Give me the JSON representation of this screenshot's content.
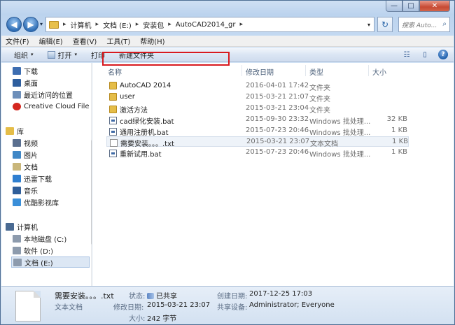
{
  "window": {
    "caption": {
      "minimize": "—",
      "maximize": "□",
      "close": "✕"
    }
  },
  "address": {
    "crumbs": [
      "计算机",
      "文档 (E:)",
      "安装包",
      "AutoCAD2014_gr"
    ],
    "search_placeholder": "搜索 Auto...",
    "back_glyph": "◀",
    "forward_glyph": "▶",
    "refresh_glyph": "↻",
    "search_glyph": "⌕",
    "separator_glyph": "▸",
    "dropdown_glyph": "▾",
    "crumb_dropdown_glyph": "▾"
  },
  "menubar": [
    "文件(F)",
    "编辑(E)",
    "查看(V)",
    "工具(T)",
    "帮助(H)"
  ],
  "toolbar": {
    "organize": "组织",
    "open": "打开",
    "print": "打印",
    "new_folder": "新建文件夹",
    "arrow_glyph": "▾",
    "view_glyph": "☷",
    "pane_glyph": "▯",
    "help_glyph": "?"
  },
  "sidebar": {
    "items": [
      {
        "label": "下载",
        "icon": "download-icon",
        "color": "#3d6db1"
      },
      {
        "label": "桌面",
        "icon": "desktop-icon",
        "color": "#2e5e9e"
      },
      {
        "label": "最近访问的位置",
        "icon": "recent-places-icon",
        "color": "#6d8fba"
      },
      {
        "label": "Creative Cloud File",
        "icon": "creative-cloud-icon",
        "color": "#d4271f"
      },
      {
        "label": "库",
        "icon": "libraries-icon",
        "color": "#e5bd48"
      },
      {
        "label": "视频",
        "icon": "videos-icon",
        "color": "#5a6f8f"
      },
      {
        "label": "图片",
        "icon": "pictures-icon",
        "color": "#3f87c6"
      },
      {
        "label": "文档",
        "icon": "documents-icon",
        "color": "#c9b67a"
      },
      {
        "label": "迅雷下载",
        "icon": "thunder-download-icon",
        "color": "#2f7fd0"
      },
      {
        "label": "音乐",
        "icon": "music-icon",
        "color": "#2f5e9a"
      },
      {
        "label": "优酷影视库",
        "icon": "youku-library-icon",
        "color": "#3a8fd9"
      },
      {
        "label": "计算机",
        "icon": "computer-icon",
        "color": "#4a6a92"
      },
      {
        "label": "本地磁盘 (C:)",
        "icon": "drive-c-icon",
        "color": "#8d9bad"
      },
      {
        "label": "软件 (D:)",
        "icon": "drive-d-icon",
        "color": "#8d9bad"
      },
      {
        "label": "文档 (E:)",
        "icon": "drive-e-icon",
        "color": "#8d9bad"
      }
    ]
  },
  "columns": {
    "name": "名称",
    "date": "修改日期",
    "type": "类型",
    "size": "大小"
  },
  "files": [
    {
      "name": "AutoCAD 2014",
      "date": "2016-04-01 17:42",
      "type": "文件夹",
      "size": "",
      "kind": "folder"
    },
    {
      "name": "user",
      "date": "2015-03-21 21:07",
      "type": "文件夹",
      "size": "",
      "kind": "folder"
    },
    {
      "name": "激活方法",
      "date": "2015-03-21 23:04",
      "type": "文件夹",
      "size": "",
      "kind": "folder"
    },
    {
      "name": "cad绿化安装.bat",
      "date": "2015-09-30 23:32",
      "type": "Windows 批处理...",
      "size": "32 KB",
      "kind": "bat"
    },
    {
      "name": "通用注册机.bat",
      "date": "2015-07-23 20:46",
      "type": "Windows 批处理...",
      "size": "1 KB",
      "kind": "bat"
    },
    {
      "name": "需要安装。。。.txt",
      "date": "2015-03-21 23:07",
      "type": "文本文档",
      "size": "1 KB",
      "kind": "txt"
    },
    {
      "name": "重新试用.bat",
      "date": "2015-07-23 20:46",
      "type": "Windows 批处理...",
      "size": "1 KB",
      "kind": "bat"
    }
  ],
  "details": {
    "name": "需要安装。。。.txt",
    "kind": "文本文档",
    "state_label": "状态:",
    "state_value": "已共享",
    "modified_label": "修改日期:",
    "modified_value": "2015-03-21 23:07",
    "size_label": "大小:",
    "size_value": "242 字节",
    "created_label": "创建日期:",
    "created_value": "2017-12-25 17:03",
    "shared_label": "共享设备:",
    "shared_value": "Administrator; Everyone"
  },
  "colors": {
    "highlight_box": "#d8191f",
    "selection": "#eef3f9"
  }
}
